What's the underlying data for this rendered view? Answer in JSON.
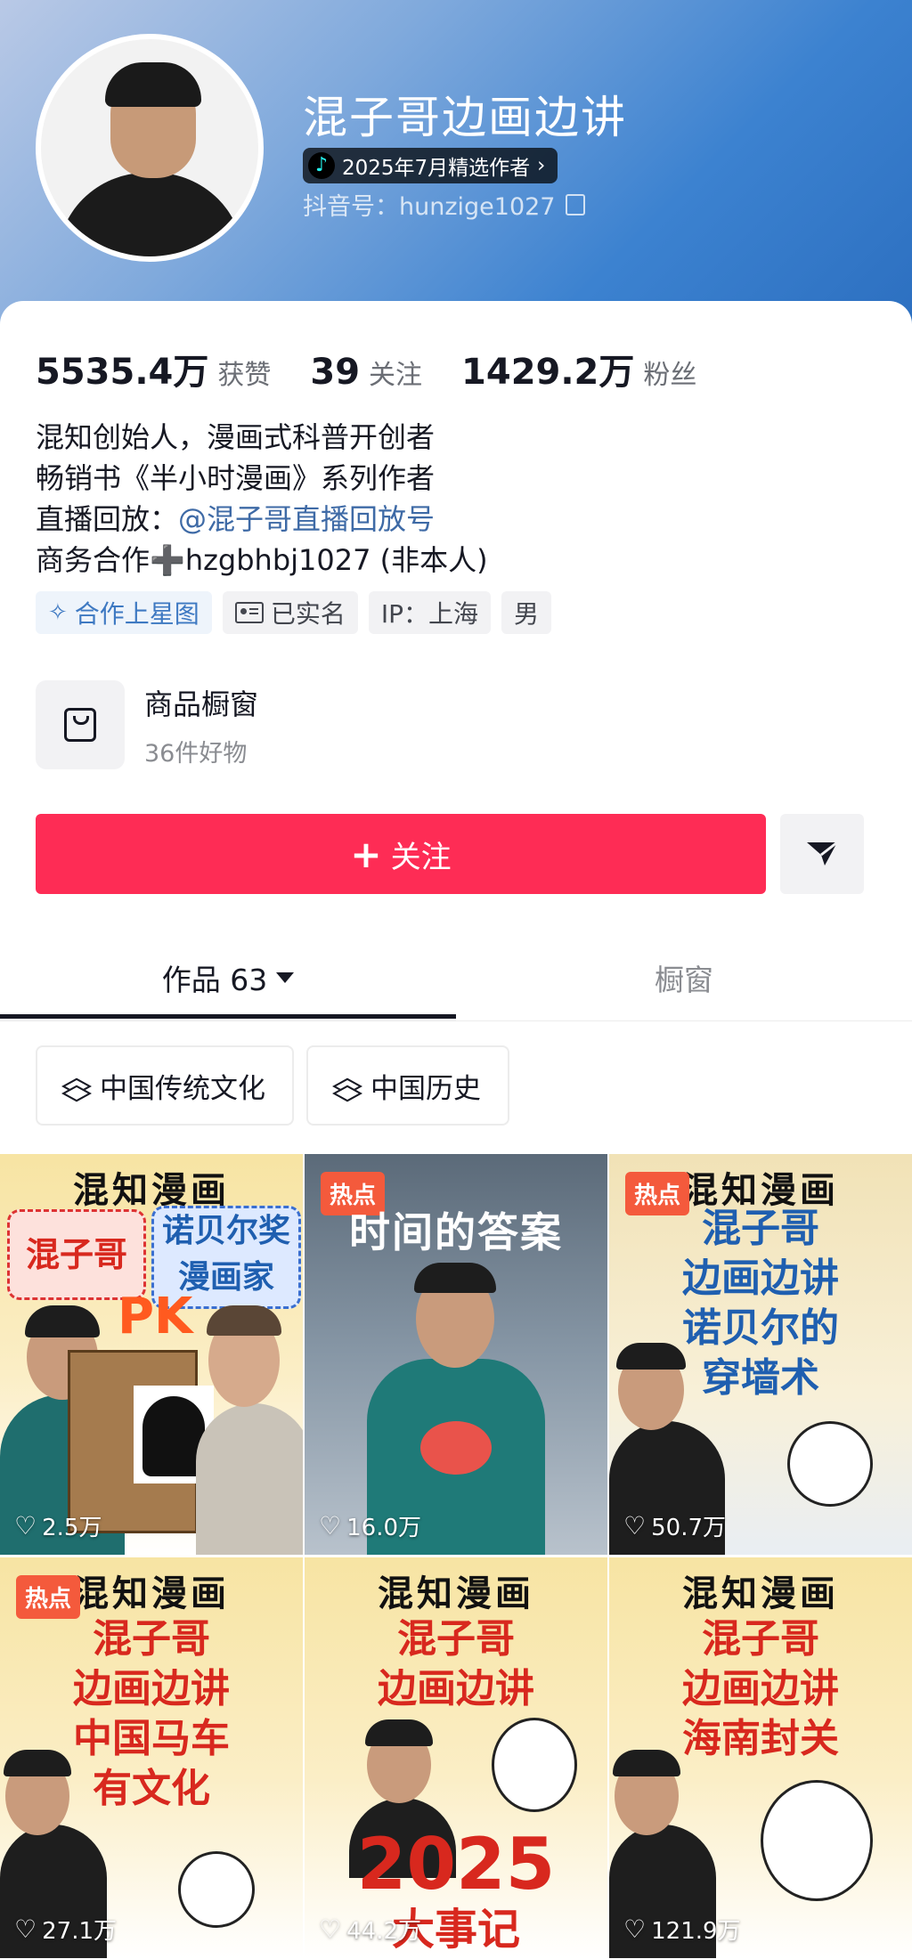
{
  "profile": {
    "name": "混子哥边画边讲",
    "badge": "2025年7月精选作者",
    "badge_arrow": "›",
    "douyin_id": "抖音号：hunzige1027"
  },
  "stats": [
    {
      "value": "5535.4万",
      "label": "获赞"
    },
    {
      "value": "39",
      "label": "关注"
    },
    {
      "value": "1429.2万",
      "label": "粉丝"
    }
  ],
  "bio": {
    "line1": "混知创始人，漫画式科普开创者",
    "line2": "畅销书《半小时漫画》系列作者",
    "line3_prefix": "直播回放：",
    "line3_mention": "@混子哥直播回放号",
    "line4": "商务合作➕hzgbhbj1027 (非本人)"
  },
  "tags": {
    "star": "合作上星图",
    "verified": "已实名",
    "ip": "IP：上海",
    "gender": "男"
  },
  "shop": {
    "title": "商品橱窗",
    "subtitle": "36件好物"
  },
  "actions": {
    "follow_plus": "+",
    "follow": "关注"
  },
  "tabs": {
    "works": "作品 63",
    "shop": "橱窗"
  },
  "collections": [
    "中国传统文化",
    "中国历史"
  ],
  "videos": [
    {
      "brand": "混知漫画",
      "left": "混子哥",
      "right": "诺贝尔奖\n漫画家",
      "pk": "PK",
      "likes": "2.5万"
    },
    {
      "hot": "热点",
      "title": "时间的答案",
      "likes": "16.0万"
    },
    {
      "hot": "热点",
      "brand": "混知漫画",
      "lines": [
        "混子哥",
        "边画边讲",
        "诺贝尔的",
        "穿墙术"
      ],
      "likes": "50.7万"
    },
    {
      "hot": "热点",
      "brand": "混知漫画",
      "lines": [
        "混子哥",
        "边画边讲",
        "中国马车",
        "有文化"
      ],
      "likes": "27.1万"
    },
    {
      "brand": "混知漫画",
      "lines": [
        "混子哥",
        "边画边讲",
        "2025",
        "大事记"
      ],
      "likes": "44.2万"
    },
    {
      "brand": "混知漫画",
      "lines": [
        "混子哥",
        "边画边讲",
        "海南封关"
      ],
      "likes": "121.9万"
    }
  ],
  "colors": {
    "follow": "#fe2c55",
    "mention": "#3e6aa6",
    "header_blue": "#3c82d0"
  }
}
